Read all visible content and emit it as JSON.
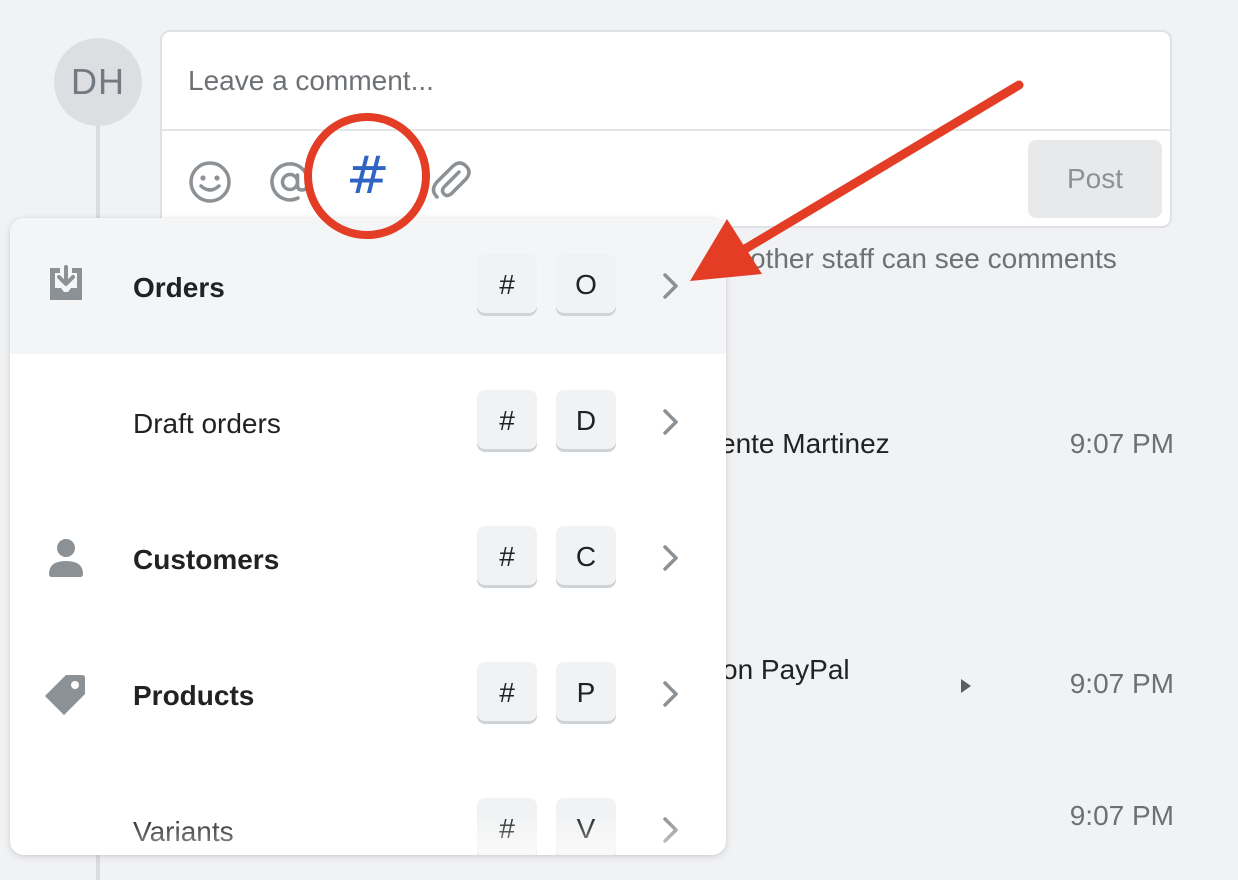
{
  "avatar": {
    "initials": "DH"
  },
  "comment": {
    "placeholder": "Leave a comment...",
    "post_label": "Post",
    "tools": [
      "emoji-icon",
      "mention-icon",
      "hashtag-icon",
      "attachment-icon"
    ],
    "hash_symbol": "#"
  },
  "notice": "other staff can see comments",
  "timeline": [
    {
      "text": "ente Martinez",
      "time": "9:07 PM"
    },
    {
      "text": "on PayPal",
      "time": "9:07 PM"
    },
    {
      "text": "",
      "time": "9:07 PM"
    }
  ],
  "menu": {
    "items": [
      {
        "label": "Orders",
        "icon": "orders-icon",
        "keys": [
          "#",
          "O"
        ],
        "bold": true,
        "active": true
      },
      {
        "label": "Draft orders",
        "icon": "",
        "keys": [
          "#",
          "D"
        ],
        "bold": false,
        "active": false
      },
      {
        "label": "Customers",
        "icon": "customer-icon",
        "keys": [
          "#",
          "C"
        ],
        "bold": true,
        "active": false
      },
      {
        "label": "Products",
        "icon": "tag-icon",
        "keys": [
          "#",
          "P"
        ],
        "bold": true,
        "active": false
      },
      {
        "label": "Variants",
        "icon": "",
        "keys": [
          "#",
          "V"
        ],
        "bold": false,
        "active": false
      }
    ]
  },
  "colors": {
    "annotation": "#e33d26",
    "hash_active": "#2f63c6",
    "background": "#f1f2f4"
  }
}
